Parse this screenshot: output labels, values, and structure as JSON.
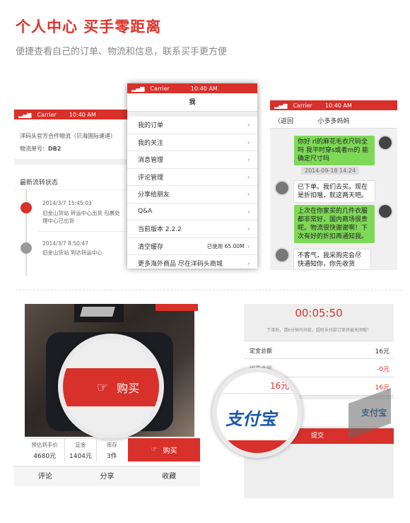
{
  "header": {
    "title": "个人中心  买手零距离",
    "subtitle": "便捷查看自己的订单、物流和信息，联系买手更方便"
  },
  "status": {
    "carrier": "Carrier",
    "time": "10:40 AM"
  },
  "logistics": {
    "line1": "洋码头官方合作物流（贝海国际速递）",
    "line2_label": "物流单号：",
    "line2_value": "DB2",
    "section_title": "最新流转状态",
    "events": [
      {
        "time": "2014/3/7 15:45:03",
        "text": "旧金山货站 转运中心出货 包裹处理中心已出货"
      },
      {
        "time": "2014/3/7 8:50:47",
        "text": "旧金山货站 到达转运中心"
      }
    ]
  },
  "me": {
    "title": "我",
    "items": [
      {
        "label": "我的订单",
        "right": ""
      },
      {
        "label": "我的关注",
        "right": ""
      },
      {
        "label": "消息管理",
        "right": ""
      },
      {
        "label": "评论管理",
        "right": ""
      },
      {
        "label": "分享给朋友",
        "right": ""
      },
      {
        "label": "Q&A",
        "right": ""
      },
      {
        "label": "当前版本 2.2.2",
        "right": ""
      },
      {
        "label": "清空缓存",
        "right": "已使用 65.00M"
      },
      {
        "label": "更多海外商品 尽在洋码头商城",
        "right": ""
      }
    ]
  },
  "chat": {
    "back": "返回",
    "title": "小多多妈妈",
    "msg1": "你好 rl的麻花毛衣尺码全吗 我平时穿s或者m的 能确定尺寸吗",
    "date": "2014-09-18 14:24",
    "msg2": "已下单。我们去买。现在是折扣哦，就这两天吧。",
    "msg3": "上次在你家买的几件衣服都非常好，国内商场很贵呢。物流很快谢谢啊！下次有好的折扣再通知我。",
    "msg4": "不客气，我采购完会尽快通知你，你先收货"
  },
  "product": {
    "buy_overlay": "购买",
    "stats": [
      {
        "label": "预估到手价",
        "value": "4680元"
      },
      {
        "label": "定金",
        "value": "1404元"
      },
      {
        "label": "库存",
        "value": "3件"
      }
    ],
    "buy_button": "购买",
    "tabs": [
      "评论",
      "分享",
      "收藏"
    ]
  },
  "pay": {
    "timer": "00:05:50",
    "notice": "下单后，请6分钟内付款，超时未付款订单将被关闭哦！",
    "total_label": "定金总额",
    "total_value": "16元",
    "discount_label": "优惠金额",
    "discount_value": "-0元",
    "pay_value": "16元",
    "pay_value2": "16元",
    "alipay": "支付宝",
    "submit": "提交"
  },
  "colors": {
    "accent": "#d8302a",
    "green_bubble": "#7ed957"
  }
}
